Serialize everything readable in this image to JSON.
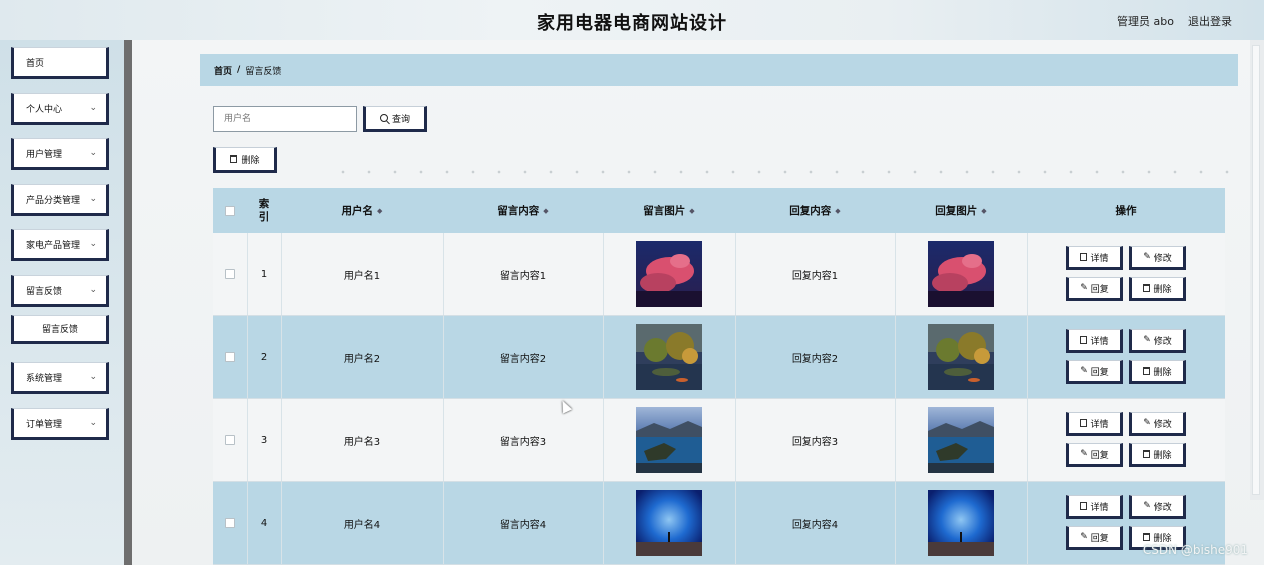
{
  "header": {
    "title": "家用电器电商网站设计",
    "admin_label": "管理员 abo",
    "logout_label": "退出登录"
  },
  "sidebar": {
    "items": [
      {
        "label": "首页",
        "has_chevron": false
      },
      {
        "label": "个人中心",
        "has_chevron": true
      },
      {
        "label": "用户管理",
        "has_chevron": true
      },
      {
        "label": "产品分类管理",
        "has_chevron": true
      },
      {
        "label": "家电产品管理",
        "has_chevron": true
      },
      {
        "label": "留言反馈",
        "has_chevron": true
      },
      {
        "label": "留言反馈",
        "has_chevron": false,
        "sub": true
      },
      {
        "label": "系统管理",
        "has_chevron": true
      },
      {
        "label": "订单管理",
        "has_chevron": true
      }
    ]
  },
  "breadcrumb": {
    "home": "首页",
    "separator": "/",
    "current": "留言反馈"
  },
  "search": {
    "placeholder": "用户名",
    "query_label": "查询"
  },
  "toolbar": {
    "delete_label": "删除"
  },
  "table": {
    "headers": {
      "index": "索引",
      "username": "用户名",
      "content": "留言内容",
      "image": "留言图片",
      "reply": "回复内容",
      "reply_image": "回复图片",
      "actions": "操作"
    },
    "rows": [
      {
        "index": "1",
        "username": "用户名1",
        "content": "留言内容1",
        "reply": "回复内容1",
        "image": "pink-cloud-night-photo"
      },
      {
        "index": "2",
        "username": "用户名2",
        "content": "留言内容2",
        "reply": "回复内容2",
        "image": "lake-trees-photo"
      },
      {
        "index": "3",
        "username": "用户名3",
        "content": "留言内容3",
        "reply": "回复内容3",
        "image": "coastal-bay-photo"
      },
      {
        "index": "4",
        "username": "用户名4",
        "content": "留言内容4",
        "reply": "回复内容4",
        "image": "blue-sky-figure-photo"
      }
    ],
    "actions": {
      "detail": "详情",
      "edit": "修改",
      "reply": "回复",
      "delete": "删除"
    }
  },
  "watermark": "CSDN @bishe901",
  "colors": {
    "accent": "#1f2a4a",
    "header_bg": "#b9d7e5",
    "row_alt": "#b9d7e5"
  }
}
